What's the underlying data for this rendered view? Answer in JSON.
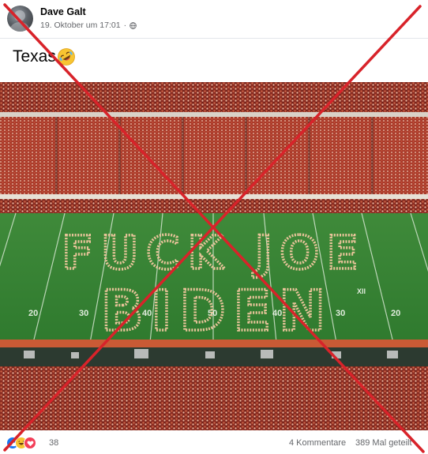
{
  "post": {
    "author": "Dave Galt",
    "timestamp": "19. Oktober um 17:01",
    "separator": "·",
    "privacy_icon": "globe-icon",
    "text": "Texas",
    "text_emoji": "rolling-on-floor-laughing-emoji"
  },
  "photo": {
    "field_text_line1": "FUCK JOE",
    "field_text_line2": "BIDEN",
    "yard_labels": [
      "20",
      "30",
      "40",
      "50",
      "40",
      "30",
      "20"
    ],
    "conference_logo": "XII"
  },
  "footer": {
    "reaction_icons": [
      "like-icon",
      "haha-icon",
      "love-icon"
    ],
    "reaction_count": "38",
    "comments": "4 Kommentare",
    "shares": "389 Mal geteilt"
  },
  "overlay": {
    "type": "red-x-cross",
    "color": "#d8232a"
  }
}
